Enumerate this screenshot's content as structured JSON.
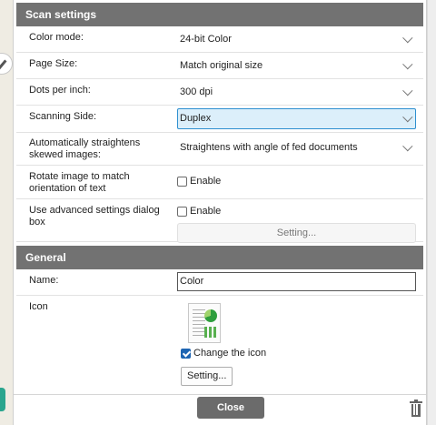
{
  "scan_settings": {
    "header": "Scan settings",
    "color_mode": {
      "label": "Color mode:",
      "value": "24-bit Color"
    },
    "page_size": {
      "label": "Page Size:",
      "value": "Match original size"
    },
    "dpi": {
      "label": "Dots per inch:",
      "value": "300 dpi"
    },
    "scanning_side": {
      "label": "Scanning Side:",
      "value": "Duplex"
    },
    "straighten": {
      "label": "Automatically straightens skewed images:",
      "value": "Straightens with angle of fed documents"
    },
    "rotate": {
      "label": "Rotate image to match orientation of text",
      "check_label": "Enable",
      "checked": false
    },
    "advanced": {
      "label": "Use advanced settings dialog box",
      "check_label": "Enable",
      "checked": false,
      "button": "Setting..."
    }
  },
  "general": {
    "header": "General",
    "name": {
      "label": "Name:",
      "value": "Color"
    },
    "icon": {
      "label": "Icon",
      "change_label": "Change the icon",
      "change_checked": true,
      "button": "Setting..."
    }
  },
  "footer": {
    "close": "Close"
  },
  "icons": {
    "document": "document-chart-icon",
    "trash": "trash-icon",
    "dropdown": "chevron-down-icon"
  },
  "colors": {
    "header_bg": "#727272",
    "active_field": "#dceffa",
    "accent": "#2e8fd0",
    "close_bg": "#6b6b6b"
  }
}
